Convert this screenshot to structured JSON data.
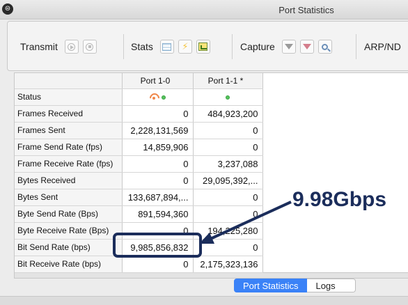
{
  "window": {
    "title": "Port Statistics"
  },
  "toolbar": {
    "transmit_label": "Transmit",
    "stats_label": "Stats",
    "capture_label": "Capture",
    "arpnd_label": "ARP/ND"
  },
  "table": {
    "headers": [
      "",
      "Port 1-0",
      "Port 1-1 *"
    ],
    "rows": [
      {
        "label": "Status",
        "p0": "",
        "p1": ""
      },
      {
        "label": "Frames Received",
        "p0": "0",
        "p1": "484,923,200"
      },
      {
        "label": "Frames Sent",
        "p0": "2,228,131,569",
        "p1": "0"
      },
      {
        "label": "Frame Send Rate (fps)",
        "p0": "14,859,906",
        "p1": "0"
      },
      {
        "label": "Frame Receive Rate (fps)",
        "p0": "0",
        "p1": "3,237,088"
      },
      {
        "label": "Bytes Received",
        "p0": "0",
        "p1": "29,095,392,..."
      },
      {
        "label": "Bytes Sent",
        "p0": "133,687,894,...",
        "p1": "0"
      },
      {
        "label": "Byte Send Rate (Bps)",
        "p0": "891,594,360",
        "p1": "0"
      },
      {
        "label": "Byte Receive Rate (Bps)",
        "p0": "0",
        "p1": "194,225,280"
      },
      {
        "label": "Bit Send Rate (bps)",
        "p0": "9,985,856,832",
        "p1": "0"
      },
      {
        "label": "Bit Receive Rate (bps)",
        "p0": "0",
        "p1": "2,175,323,136"
      }
    ]
  },
  "annotation": {
    "text": "9.98Gbps",
    "color": "#1b2d5b"
  },
  "tabs": {
    "port_statistics": "Port Statistics",
    "logs": "Logs"
  },
  "colors": {
    "accent": "#3a82f7",
    "led_green": "#55c35d",
    "status_orange": "#f0884a"
  }
}
